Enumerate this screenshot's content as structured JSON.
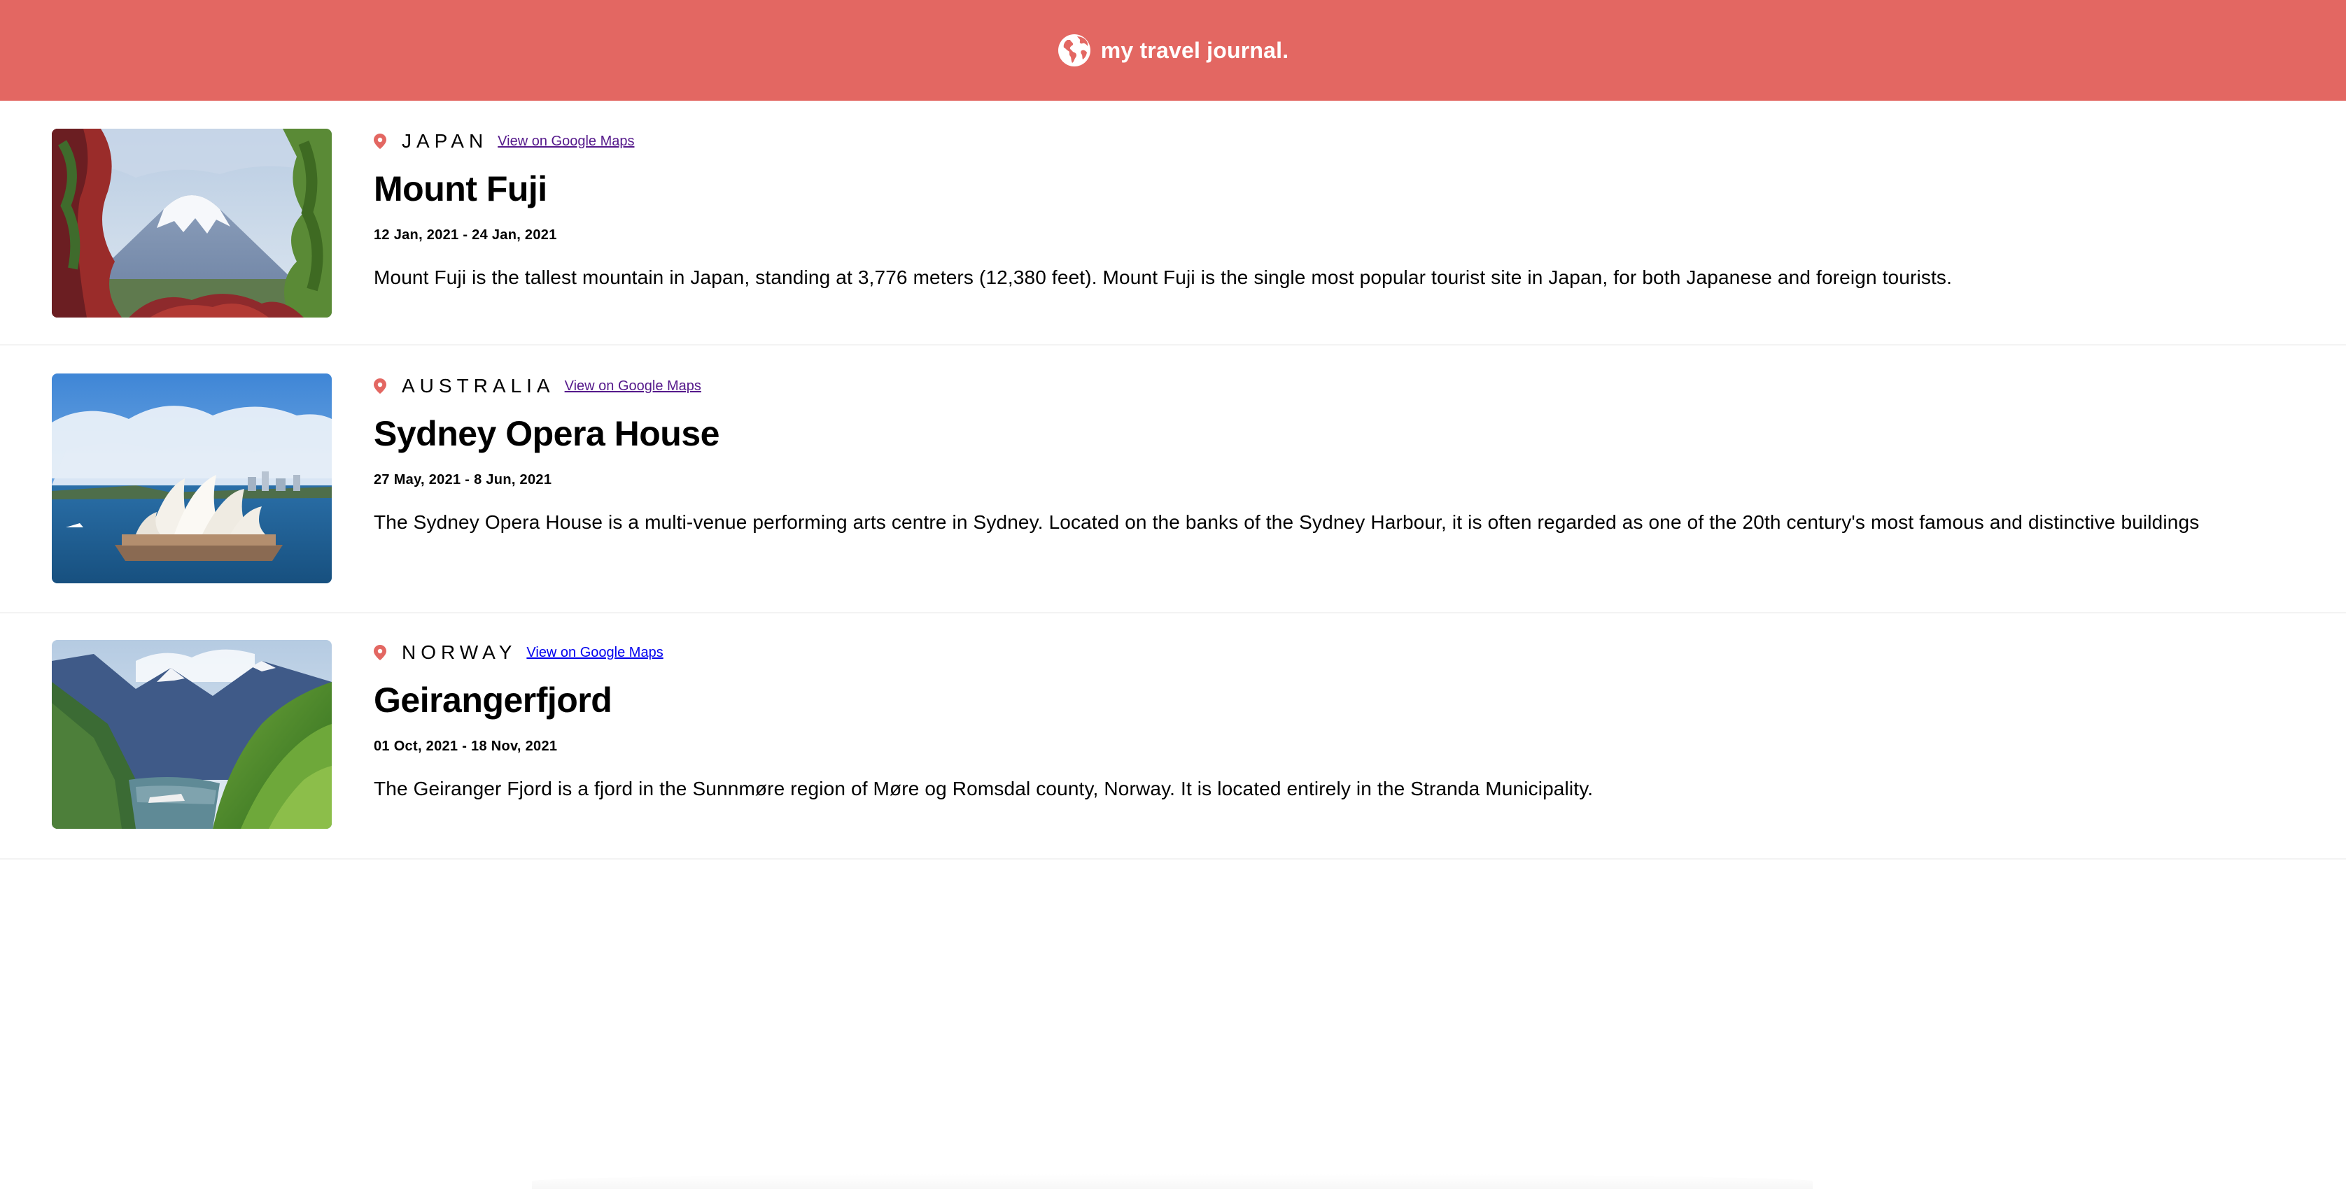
{
  "header": {
    "title": "my travel journal.",
    "icon": "globe-icon",
    "background": "#E36762"
  },
  "entries": [
    {
      "country": "JAPAN",
      "map_link": "View on Google Maps",
      "title": "Mount Fuji",
      "dates": "12 Jan, 2021 - 24 Jan, 2021",
      "description": "Mount Fuji is the tallest mountain in Japan, standing at 3,776 meters (12,380 feet). Mount Fuji is the single most popular tourist site in Japan, for both Japanese and foreign tourists."
    },
    {
      "country": "AUSTRALIA",
      "map_link": "View on Google Maps",
      "title": "Sydney Opera House",
      "dates": "27 May, 2021 - 8 Jun, 2021",
      "description": "The Sydney Opera House is a multi-venue performing arts centre in Sydney. Located on the banks of the Sydney Harbour, it is often regarded as one of the 20th century's most famous and distinctive buildings"
    },
    {
      "country": "NORWAY",
      "map_link": "View on Google Maps",
      "title": "Geirangerfjord",
      "dates": "01 Oct, 2021 - 18 Nov, 2021",
      "description": "The Geiranger Fjord is a fjord in the Sunnmøre region of Møre og Romsdal county, Norway. It is located entirely in the Stranda Municipality."
    }
  ],
  "colors": {
    "accent": "#E36762",
    "visited_link": "#55198B",
    "link": "#0000EE"
  }
}
